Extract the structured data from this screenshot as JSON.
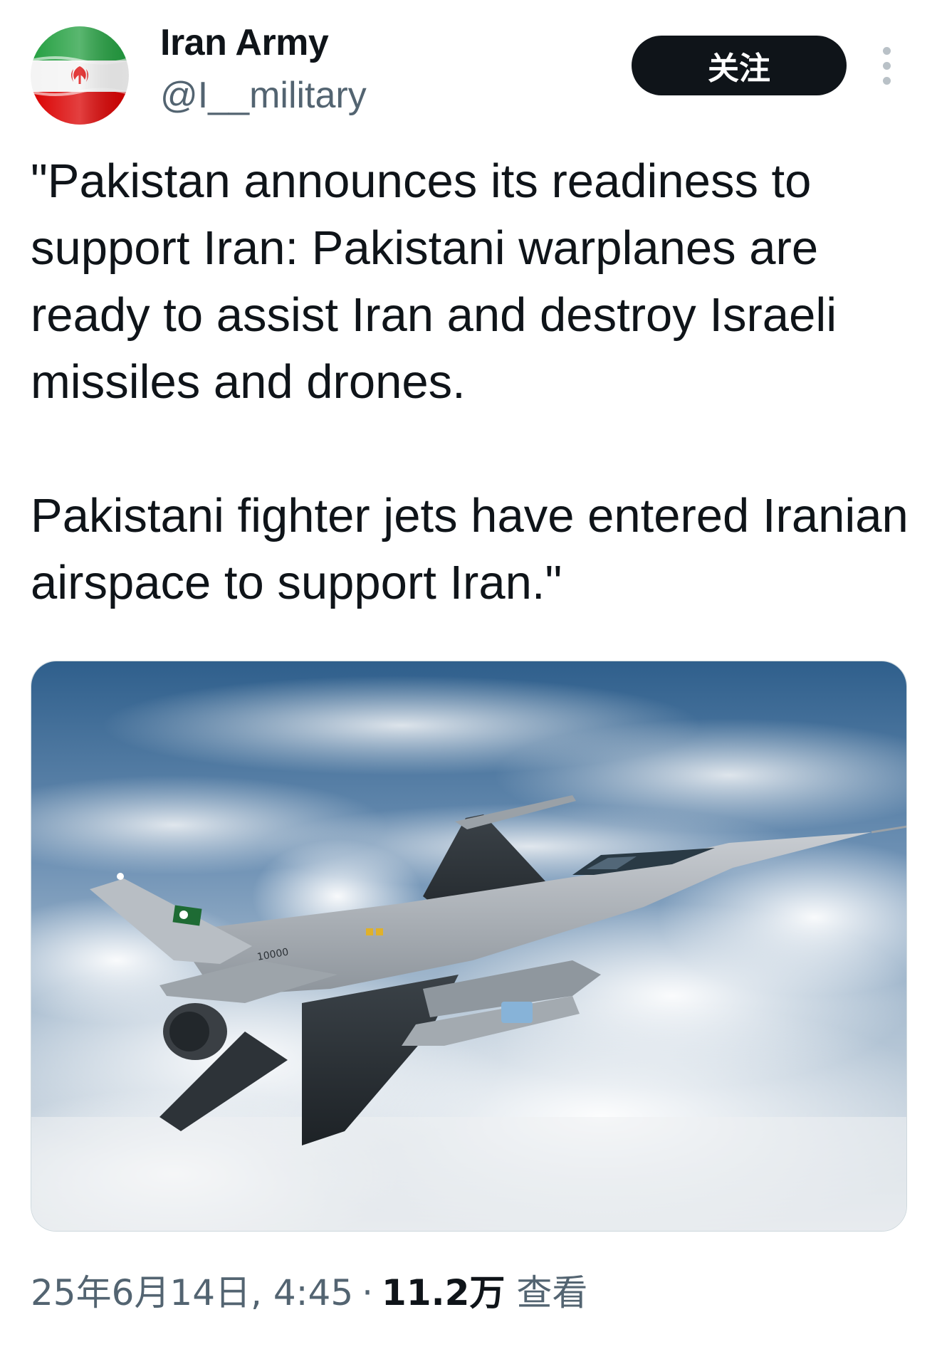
{
  "author": {
    "display_name": "Iran Army",
    "handle": "@I__military",
    "avatar_icon": "iran-flag-avatar",
    "flag_colors": {
      "green": "#239f40",
      "white": "#ffffff",
      "red": "#da0000"
    }
  },
  "header": {
    "follow_label": "关注",
    "more_icon": "more-vertical-icon"
  },
  "tweet": {
    "text": "\"Pakistan announces its readiness to support Iran: Pakistani warplanes are ready to assist Iran and destroy Israeli missiles and drones.\n\nPakistani fighter jets have entered Iranian airspace to support Iran.\""
  },
  "media": {
    "type": "photo",
    "subject": "fighter-jet-above-clouds",
    "tail_marking": "10000"
  },
  "meta": {
    "date": "25年6月14日, 4:45",
    "separator": "·",
    "views_count": "11.2万",
    "views_label": "查看"
  },
  "colors": {
    "text_primary": "#0f1419",
    "text_secondary": "#536471",
    "button_bg": "#0f1419",
    "button_text": "#ffffff"
  }
}
